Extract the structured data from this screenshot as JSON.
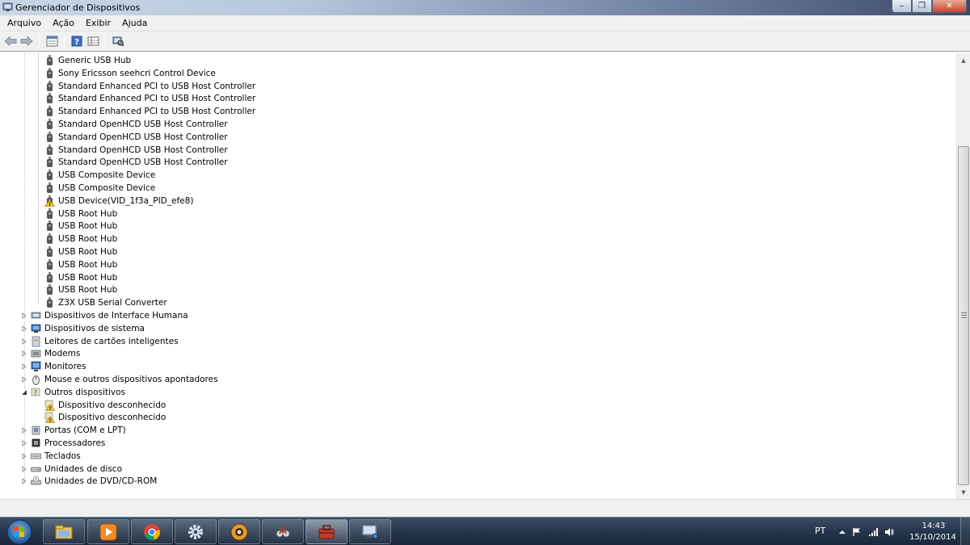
{
  "window": {
    "title": "Gerenciador de Dispositivos",
    "minimize_glyph": "‒",
    "maximize_glyph": "❐",
    "close_glyph": "✕"
  },
  "menu": {
    "items": [
      "Arquivo",
      "Ação",
      "Exibir",
      "Ajuda"
    ]
  },
  "toolbar": {
    "buttons": [
      "back-arrow-icon",
      "forward-arrow-icon",
      "properties-icon",
      "help-icon",
      "view-icon",
      "scan-hardware-icon"
    ]
  },
  "tree": {
    "usb_children": [
      {
        "label": "Generic USB Hub",
        "warning": false
      },
      {
        "label": "Sony Ericsson seehcri Control Device",
        "warning": false
      },
      {
        "label": "Standard Enhanced PCI to USB Host Controller",
        "warning": false
      },
      {
        "label": "Standard Enhanced PCI to USB Host Controller",
        "warning": false
      },
      {
        "label": "Standard Enhanced PCI to USB Host Controller",
        "warning": false
      },
      {
        "label": "Standard OpenHCD USB Host Controller",
        "warning": false
      },
      {
        "label": "Standard OpenHCD USB Host Controller",
        "warning": false
      },
      {
        "label": "Standard OpenHCD USB Host Controller",
        "warning": false
      },
      {
        "label": "Standard OpenHCD USB Host Controller",
        "warning": false
      },
      {
        "label": "USB Composite Device",
        "warning": false
      },
      {
        "label": "USB Composite Device",
        "warning": false
      },
      {
        "label": "USB Device(VID_1f3a_PID_efe8)",
        "warning": true
      },
      {
        "label": "USB Root Hub",
        "warning": false
      },
      {
        "label": "USB Root Hub",
        "warning": false
      },
      {
        "label": "USB Root Hub",
        "warning": false
      },
      {
        "label": "USB Root Hub",
        "warning": false
      },
      {
        "label": "USB Root Hub",
        "warning": false
      },
      {
        "label": "USB Root Hub",
        "warning": false
      },
      {
        "label": "USB Root Hub",
        "warning": false
      },
      {
        "label": "Z3X USB Serial Converter",
        "warning": false
      }
    ],
    "categories_a": [
      {
        "label": "Dispositivos de Interface Humana",
        "icon": "hid-icon",
        "expanded": false
      },
      {
        "label": "Dispositivos de sistema",
        "icon": "system-icon",
        "expanded": false
      },
      {
        "label": "Leitores de cartões inteligentes",
        "icon": "smartcard-icon",
        "expanded": false
      },
      {
        "label": "Modems",
        "icon": "modem-icon",
        "expanded": false
      },
      {
        "label": "Monitores",
        "icon": "monitor-icon",
        "expanded": false
      },
      {
        "label": "Mouse e outros dispositivos apontadores",
        "icon": "mouse-icon",
        "expanded": false
      },
      {
        "label": "Outros dispositivos",
        "icon": "other-devices-icon",
        "expanded": true
      }
    ],
    "other_children": [
      {
        "label": "Dispositivo desconhecido",
        "warning": true
      },
      {
        "label": "Dispositivo desconhecido",
        "warning": true
      }
    ],
    "categories_b": [
      {
        "label": "Portas (COM e LPT)",
        "icon": "ports-icon",
        "expanded": false
      },
      {
        "label": "Processadores",
        "icon": "processor-icon",
        "expanded": false
      },
      {
        "label": "Teclados",
        "icon": "keyboard-icon",
        "expanded": false
      },
      {
        "label": "Unidades de disco",
        "icon": "disk-drive-icon",
        "expanded": false
      },
      {
        "label": "Unidades de DVD/CD-ROM",
        "icon": "dvd-drive-icon",
        "expanded": false
      }
    ]
  },
  "taskbar": {
    "apps": [
      "windows-explorer-icon",
      "media-player-icon",
      "chrome-icon",
      "settings-gear-icon",
      "app-5-icon",
      "app-6-icon",
      "app-7-icon",
      "device-manager-icon"
    ],
    "active_index": 6
  },
  "tray": {
    "language": "PT",
    "time": "14:43",
    "date": "15/10/2014"
  },
  "colors": {
    "warning": "#f3c321",
    "taskbar": "#25364c"
  }
}
